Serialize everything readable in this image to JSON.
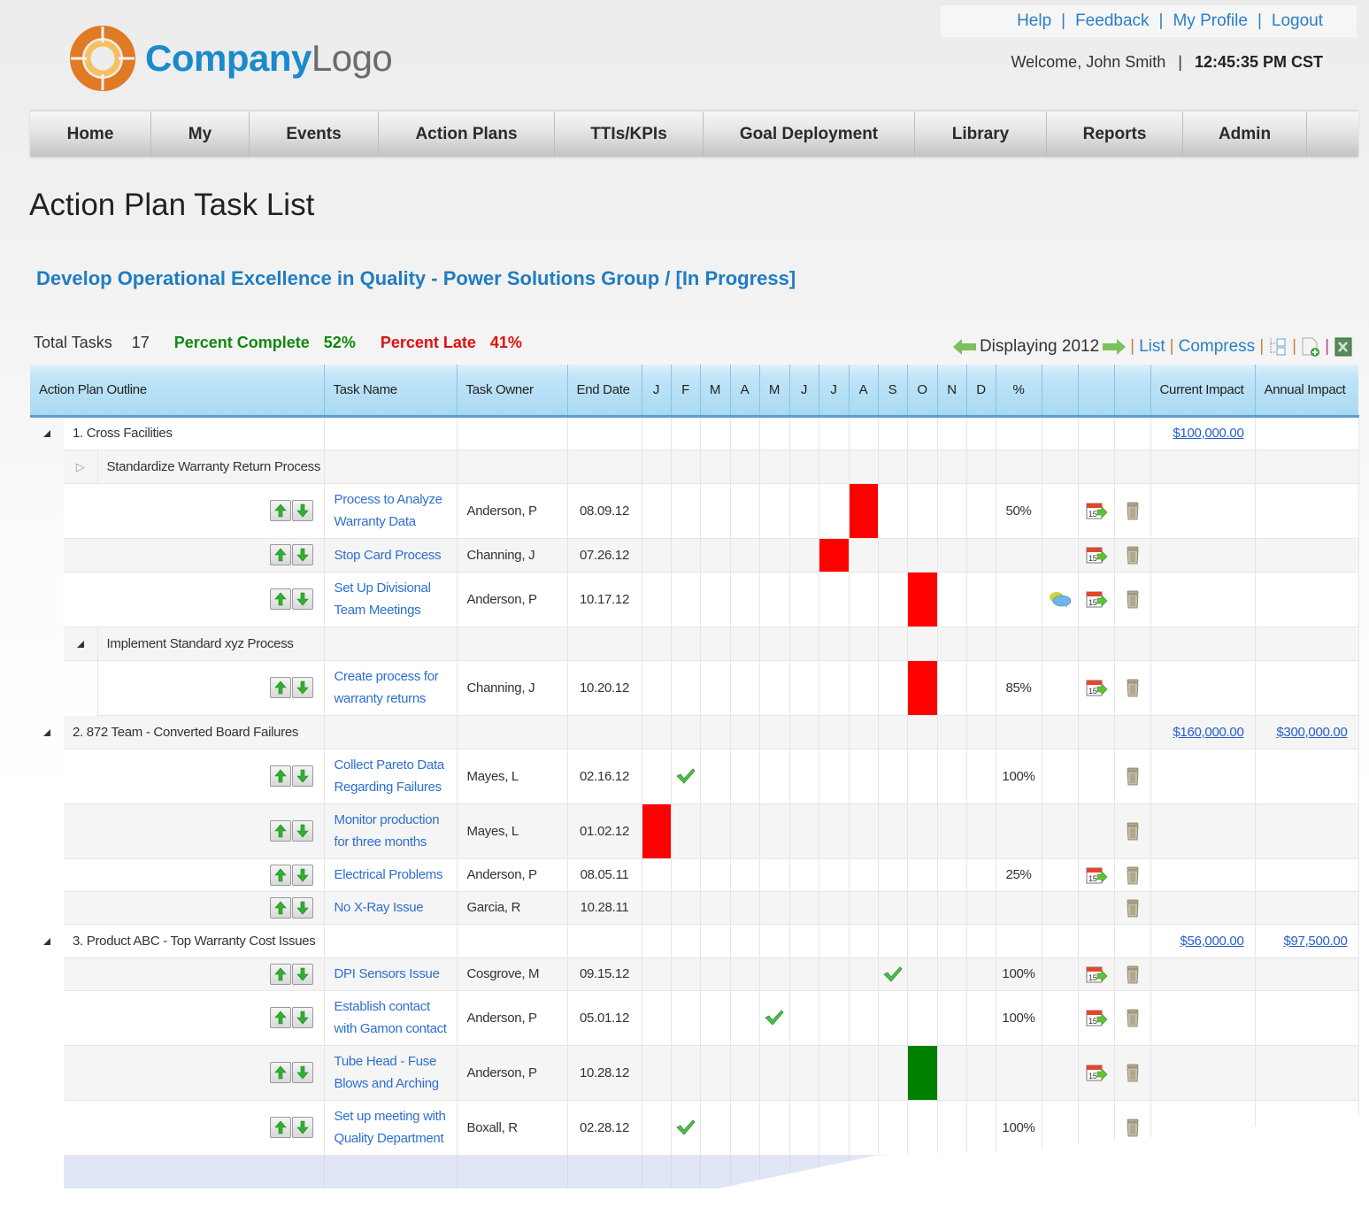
{
  "header": {
    "logo": {
      "part1": "Company",
      "part2": "Logo"
    },
    "links": [
      "Help",
      "Feedback",
      "My Profile",
      "Logout"
    ],
    "welcome": "Welcome, John Smith",
    "time": "12:45:35 PM CST"
  },
  "nav": [
    "Home",
    "My",
    "Events",
    "Action Plans",
    "TTIs/KPIs",
    "Goal Deployment",
    "Library",
    "Reports",
    "Admin"
  ],
  "page_title": "Action Plan Task List",
  "plan_title": "Develop Operational Excellence in Quality - Power Solutions Group / [In Progress]",
  "stats": {
    "total_label": "Total Tasks",
    "total_value": "17",
    "complete_label": "Percent Complete",
    "complete_value": "52%",
    "late_label": "Percent Late",
    "late_value": "41%"
  },
  "toolbar": {
    "displaying": "Displaying 2012",
    "list": "List",
    "compress": "Compress",
    "icons": [
      "prev-year-arrow",
      "next-year-arrow",
      "outline-view-icon",
      "add-document-icon",
      "export-excel-icon"
    ]
  },
  "columns": {
    "outline": "Action Plan Outline",
    "task": "Task Name",
    "owner": "Task Owner",
    "end": "End Date",
    "months": [
      "J",
      "F",
      "M",
      "A",
      "M",
      "J",
      "J",
      "A",
      "S",
      "O",
      "N",
      "D"
    ],
    "pct": "%",
    "current": "Current Impact",
    "annual": "Annual Impact"
  },
  "colors": {
    "late": "#ff0000",
    "on_track": "#008000",
    "link": "#2d6fcf",
    "header": "#a9daf3"
  },
  "groups": [
    {
      "label": "1. Cross Facilities",
      "current_impact": "$100,000.00",
      "annual_impact": "",
      "subgroups": [
        {
          "label": "Standardize Warranty Return Process",
          "expanded": false,
          "tasks": [
            {
              "name": "Process to Analyze Warranty Data",
              "owner": "Anderson, P",
              "end": "08.09.12",
              "month": 8,
              "status": "late",
              "pct": "50%",
              "comment": false,
              "reschedule": true
            },
            {
              "name": "Stop Card Process",
              "owner": "Channing, J",
              "end": "07.26.12",
              "month": 7,
              "status": "late",
              "pct": "",
              "comment": false,
              "reschedule": true
            },
            {
              "name": "Set Up Divisional Team Meetings",
              "owner": "Anderson, P",
              "end": "10.17.12",
              "month": 10,
              "status": "late",
              "pct": "",
              "comment": true,
              "reschedule": true
            }
          ]
        },
        {
          "label": "Implement Standard xyz Process",
          "expanded": true,
          "tasks": [
            {
              "name": "Create process for warranty returns",
              "owner": "Channing, J",
              "end": "10.20.12",
              "month": 10,
              "status": "late",
              "pct": "85%",
              "comment": false,
              "reschedule": true
            }
          ]
        }
      ]
    },
    {
      "label": "2. 872 Team - Converted Board Failures",
      "current_impact": "$160,000.00",
      "annual_impact": "$300,000.00",
      "tasks": [
        {
          "name": "Collect Pareto Data Regarding Failures",
          "owner": "Mayes, L",
          "end": "02.16.12",
          "month": 2,
          "status": "done",
          "pct": "100%",
          "comment": false,
          "reschedule": false
        },
        {
          "name": "Monitor production for three months",
          "owner": "Mayes, L",
          "end": "01.02.12",
          "month": 1,
          "status": "late",
          "pct": "",
          "comment": false,
          "reschedule": false
        },
        {
          "name": "Electrical Problems",
          "owner": "Anderson, P",
          "end": "08.05.11",
          "month": null,
          "status": "",
          "pct": "25%",
          "comment": false,
          "reschedule": true
        },
        {
          "name": "No X-Ray Issue",
          "owner": "Garcia, R",
          "end": "10.28.11",
          "month": null,
          "status": "",
          "pct": "",
          "comment": false,
          "reschedule": false
        }
      ]
    },
    {
      "label": "3. Product ABC - Top Warranty Cost Issues",
      "current_impact": "$56,000.00",
      "annual_impact": "$97,500.00",
      "tasks": [
        {
          "name": "DPI Sensors Issue",
          "owner": "Cosgrove, M",
          "end": "09.15.12",
          "month": 9,
          "status": "done",
          "pct": "100%",
          "comment": false,
          "reschedule": true
        },
        {
          "name": "Establish contact with Gamon contact",
          "owner": "Anderson, P",
          "end": "05.01.12",
          "month": 5,
          "status": "done",
          "pct": "100%",
          "comment": false,
          "reschedule": true
        },
        {
          "name": "Tube Head - Fuse Blows and Arching",
          "owner": "Anderson, P",
          "end": "10.28.12",
          "month": 10,
          "status": "on_track",
          "pct": "",
          "comment": false,
          "reschedule": true
        },
        {
          "name": "Set up meeting with Quality Department",
          "owner": "Boxall, R",
          "end": "02.28.12",
          "month": 2,
          "status": "done",
          "pct": "100%",
          "comment": false,
          "reschedule": false
        }
      ]
    }
  ]
}
